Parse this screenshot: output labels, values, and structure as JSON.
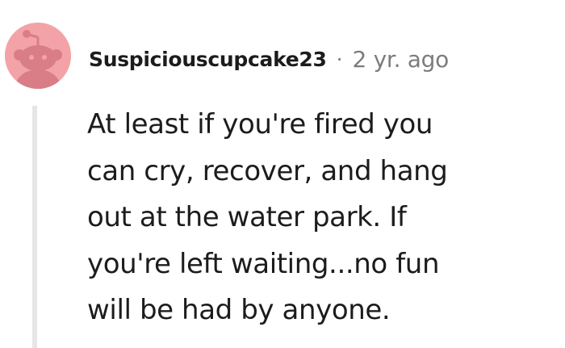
{
  "comment": {
    "username": "Suspiciouscupcake23",
    "separator": "·",
    "timestamp": "2 yr. ago",
    "body_lines": [
      "At least if you're fired you",
      "can cry, recover, and hang",
      "out at the water park. If",
      "you're left waiting...no fun",
      "will be had by anyone."
    ],
    "avatar_icon": "reddit-snoo-avatar-icon"
  },
  "colors": {
    "avatar_background": "#f3a3a8",
    "avatar_figure": "#d97e86",
    "username": "#1c1c1c",
    "meta": "#7c7c7c",
    "thread_line": "#e6e6e6",
    "body_text": "#1c1c1c"
  }
}
